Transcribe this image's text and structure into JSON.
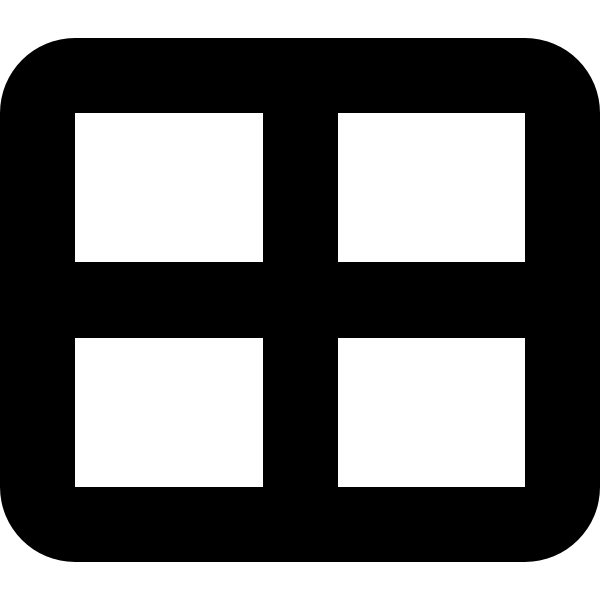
{
  "icon": {
    "name": "grid-2x2-icon",
    "color": "#000000",
    "background": "#ffffff",
    "cells": [
      "top-left",
      "top-right",
      "bottom-left",
      "bottom-right"
    ]
  }
}
